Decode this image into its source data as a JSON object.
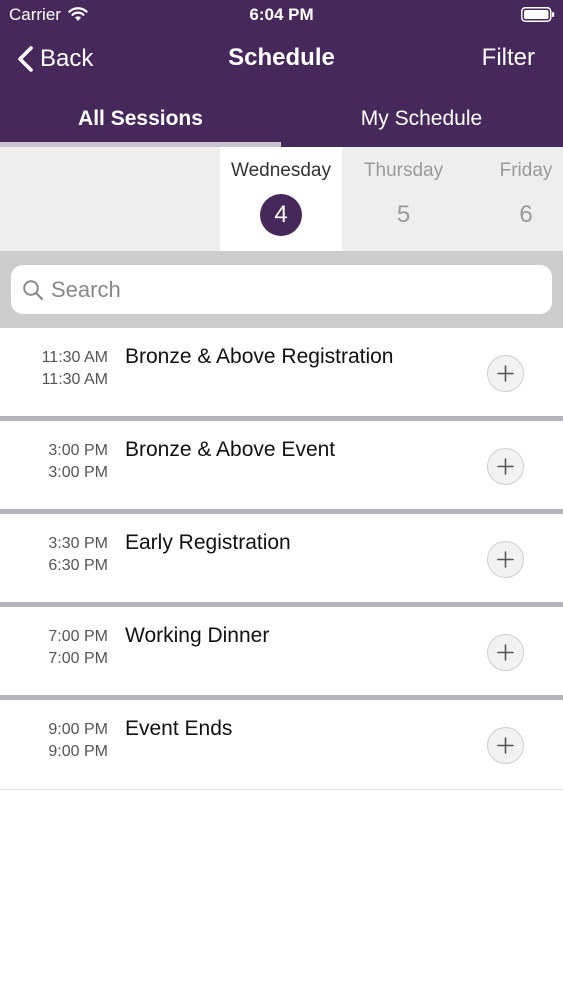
{
  "status": {
    "carrier": "Carrier",
    "time": "6:04 PM"
  },
  "nav": {
    "back_label": "Back",
    "title": "Schedule",
    "filter_label": "Filter"
  },
  "tabs": [
    {
      "label": "All Sessions",
      "active": true
    },
    {
      "label": "My Schedule",
      "active": false
    }
  ],
  "days": [
    {
      "name": "Wednesday",
      "number": "4",
      "selected": true
    },
    {
      "name": "Thursday",
      "number": "5",
      "selected": false
    },
    {
      "name": "Friday",
      "number": "6",
      "selected": false
    }
  ],
  "search": {
    "placeholder": "Search"
  },
  "sessions": [
    {
      "start": "11:30 AM",
      "end": "11:30 AM",
      "title": "Bronze & Above Registration"
    },
    {
      "start": "3:00 PM",
      "end": "3:00 PM",
      "title": "Bronze & Above Event"
    },
    {
      "start": "3:30 PM",
      "end": "6:30 PM",
      "title": "Early Registration"
    },
    {
      "start": "7:00 PM",
      "end": "7:00 PM",
      "title": "Working Dinner"
    },
    {
      "start": "9:00 PM",
      "end": "9:00 PM",
      "title": "Event Ends"
    }
  ],
  "colors": {
    "brand": "#46295a",
    "tab_indicator": "#c9c3d0",
    "separator": "#b7b3bd"
  },
  "icons": {
    "back": "chevron-left-icon",
    "search": "search-icon",
    "add": "plus-icon",
    "wifi": "wifi-icon",
    "battery": "battery-icon"
  }
}
